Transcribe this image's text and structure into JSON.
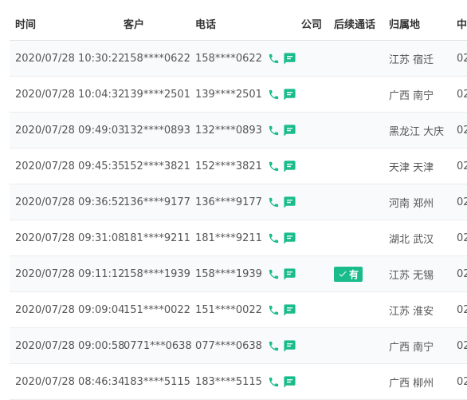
{
  "table": {
    "headers": [
      "时间",
      "客户",
      "电话",
      "公司",
      "后续通话",
      "归属地",
      "中"
    ],
    "rows": [
      {
        "time": "2020/07/28 10:30:22",
        "customer": "158****0622",
        "phone": "158****0622",
        "company": "",
        "followup": "",
        "location": "江苏 宿迁",
        "extra": "02"
      },
      {
        "time": "2020/07/28 10:04:32",
        "customer": "139****2501",
        "phone": "139****2501",
        "company": "",
        "followup": "",
        "location": "广西 南宁",
        "extra": "02"
      },
      {
        "time": "2020/07/28 09:49:03",
        "customer": "132****0893",
        "phone": "132****0893",
        "company": "",
        "followup": "",
        "location": "黑龙江 大庆",
        "extra": "02"
      },
      {
        "time": "2020/07/28 09:45:35",
        "customer": "152****3821",
        "phone": "152****3821",
        "company": "",
        "followup": "",
        "location": "天津 天津",
        "extra": "02"
      },
      {
        "time": "2020/07/28 09:36:52",
        "customer": "136****9177",
        "phone": "136****9177",
        "company": "",
        "followup": "",
        "location": "河南 郑州",
        "extra": "02"
      },
      {
        "time": "2020/07/28 09:31:08",
        "customer": "181****9211",
        "phone": "181****9211",
        "company": "",
        "followup": "",
        "location": "湖北 武汉",
        "extra": "02"
      },
      {
        "time": "2020/07/28 09:11:12",
        "customer": "158****1939",
        "phone": "158****1939",
        "company": "",
        "followup": "有",
        "location": "江苏 无锡",
        "extra": "02"
      },
      {
        "time": "2020/07/28 09:09:04",
        "customer": "151****0022",
        "phone": "151****0022",
        "company": "",
        "followup": "",
        "location": "江苏 淮安",
        "extra": "02"
      },
      {
        "time": "2020/07/28 09:00:58",
        "customer": "0771***0638",
        "phone": "077****0638",
        "company": "",
        "followup": "",
        "location": "广西 南宁",
        "extra": "02"
      },
      {
        "time": "2020/07/28 08:46:34",
        "customer": "183****5115",
        "phone": "183****5115",
        "company": "",
        "followup": "",
        "location": "广西 柳州",
        "extra": "02"
      }
    ]
  },
  "icons": {
    "phone": "phone-icon",
    "message": "message-icon",
    "check": "check-icon"
  },
  "colors": {
    "accent": "#1abc8c",
    "text": "#555555",
    "header_text": "#333333",
    "stripe": "#f9fafb",
    "border": "#ececec"
  }
}
